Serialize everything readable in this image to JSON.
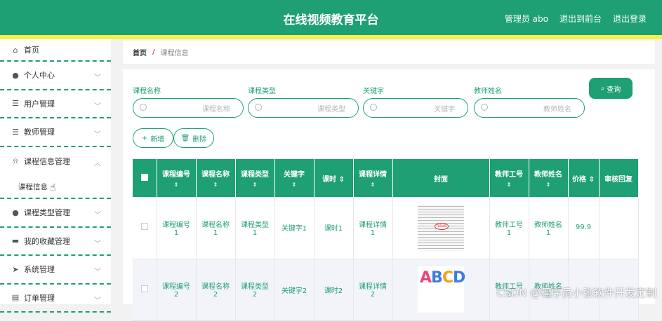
{
  "header": {
    "title": "在线视频教育平台",
    "admin": "管理员 abo",
    "exit_front": "退出到前台",
    "logout": "退出登录"
  },
  "sidebar": {
    "items": [
      {
        "label": "首页",
        "icon": "home-icon"
      },
      {
        "label": "个人中心",
        "icon": "user-icon"
      },
      {
        "label": "用户管理",
        "icon": "list-icon"
      },
      {
        "label": "教师管理",
        "icon": "list-icon"
      },
      {
        "label": "课程信息管理",
        "icon": "bell-off-icon"
      },
      {
        "label": "课程类型管理",
        "icon": "user-icon"
      },
      {
        "label": "我的收藏管理",
        "icon": "monitor-icon"
      },
      {
        "label": "系统管理",
        "icon": "send-icon"
      },
      {
        "label": "订单管理",
        "icon": "doc-icon"
      }
    ],
    "sub_item": "课程信息"
  },
  "breadcrumb": {
    "home": "首页",
    "separator": "/",
    "current": "课程信息"
  },
  "search": {
    "fields": [
      {
        "label": "课程名称",
        "placeholder": "课程名称"
      },
      {
        "label": "课程类型",
        "placeholder": "课程类型"
      },
      {
        "label": "关键字",
        "placeholder": "关键字"
      },
      {
        "label": "教师姓名",
        "placeholder": "教师姓名"
      }
    ],
    "query_label": "查询"
  },
  "actions": {
    "add_label": "新增",
    "delete_label": "删除"
  },
  "table": {
    "headers": [
      "课程编号",
      "课程名称",
      "课程类型",
      "关键字",
      "课时",
      "课程详情",
      "封面",
      "教师工号",
      "教师姓名",
      "价格",
      "审核回复"
    ],
    "rows": [
      {
        "code": "课程编号",
        "code_n": "1",
        "name": "课程名称",
        "name_n": "1",
        "type": "课程类型",
        "type_n": "1",
        "keyword": "关键字1",
        "hours": "课时1",
        "detail": "课程详情",
        "detail_n": "1",
        "cover_text": "have",
        "teacher_no": "教师工号",
        "teacher_no_n": "1",
        "teacher_name": "教师姓名",
        "teacher_name_n": "1",
        "price": "99.9"
      },
      {
        "code": "课程编号",
        "code_n": "2",
        "name": "课程名称",
        "name_n": "2",
        "type": "课程类型",
        "type_n": "2",
        "keyword": "关键字2",
        "hours": "课时2",
        "detail": "课程详情",
        "detail_n": "2",
        "cover_text": "ABCD",
        "teacher_no": "教师工号",
        "teacher_no_n": "2",
        "teacher_name": "教师姓名",
        "teacher_name_n": "2",
        "price": ""
      }
    ]
  },
  "watermark": "CSDN @程序员小张软件开发定制",
  "colors": {
    "primary": "#1e9f74",
    "accent_bar": "#f7f044"
  }
}
